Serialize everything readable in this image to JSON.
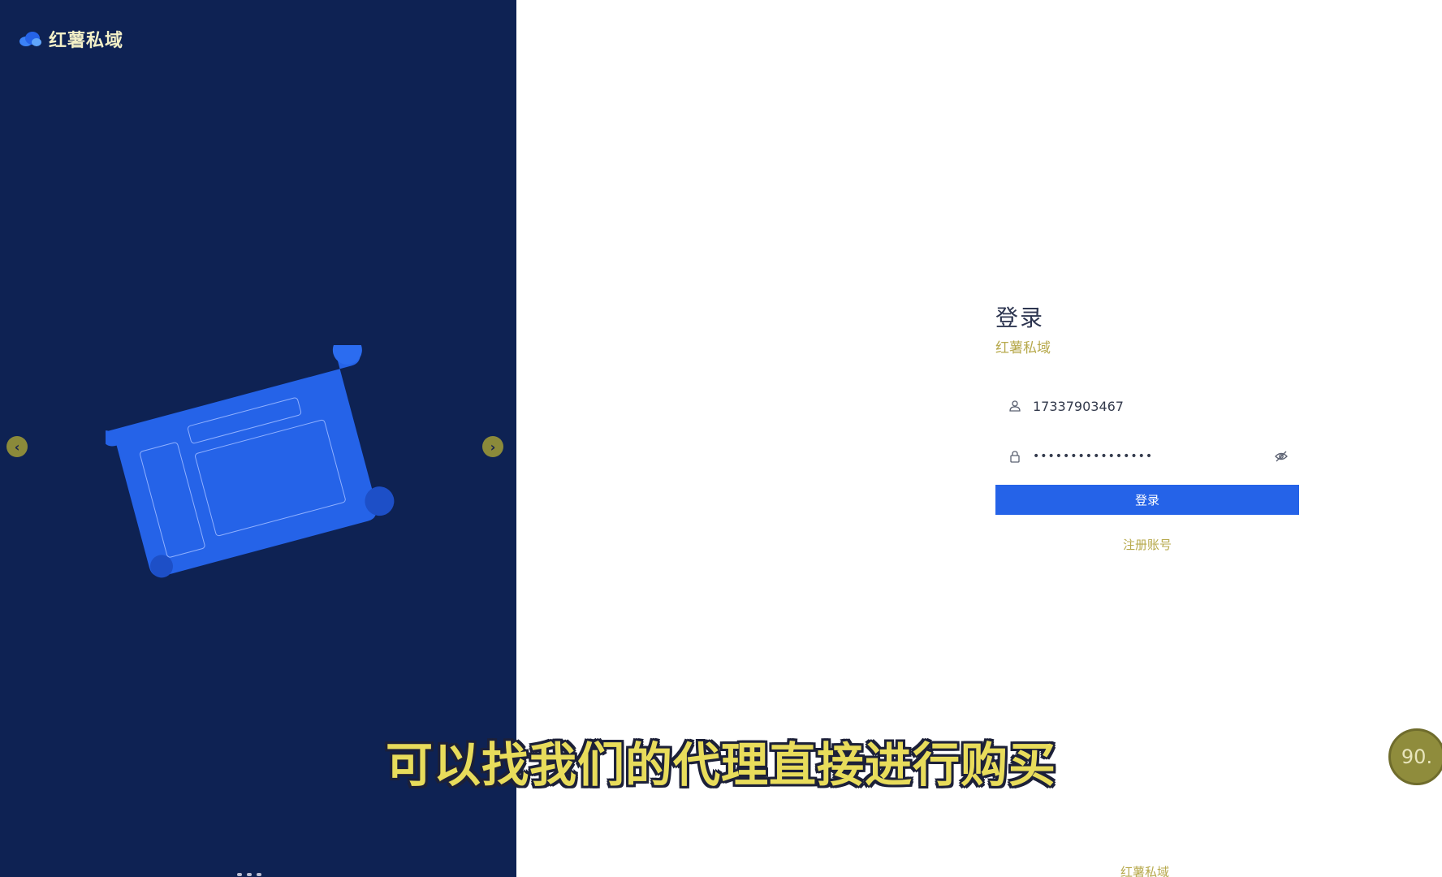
{
  "brand": {
    "name": "红薯私域",
    "logo_icon": "cloud-icon"
  },
  "carousel": {
    "prev_icon": "chevron-left-icon",
    "next_icon": "chevron-right-icon",
    "prev_glyph": "‹",
    "next_glyph": "›"
  },
  "login": {
    "title": "登录",
    "subtitle": "红薯私域",
    "username_value": "17337903467",
    "password_value": "••••••••••••••••",
    "submit_label": "登录",
    "register_label": "注册账号"
  },
  "footer": {
    "brand": "红薯私域"
  },
  "overlay": {
    "caption": "可以找我们的代理直接进行购买",
    "widget_text": "90."
  },
  "colors": {
    "left_panel": "#0e2253",
    "accent": "#2563e8",
    "muted_link": "#b7a94c"
  }
}
